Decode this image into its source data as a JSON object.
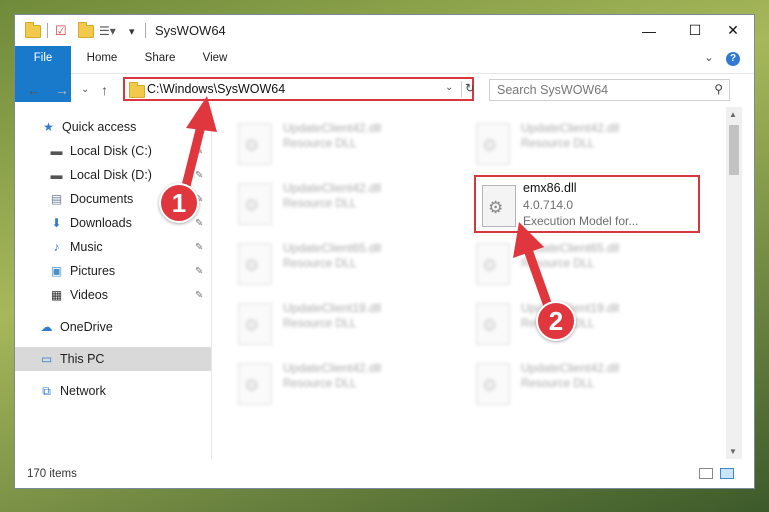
{
  "window": {
    "title": "SysWOW64",
    "controls": {
      "minimize": "—",
      "maximize": "☐",
      "close": "✕"
    }
  },
  "ribbon": {
    "tabs": [
      "File",
      "Home",
      "Share",
      "View"
    ],
    "expand": "⌄",
    "help": "?"
  },
  "nav": {
    "back": "←",
    "forward": "→",
    "recent": "⌄",
    "up": "↑"
  },
  "address": {
    "path": "C:\\Windows\\SysWOW64",
    "dropdown": "⌄",
    "refresh": "↻"
  },
  "search": {
    "placeholder": "Search SysWOW64",
    "icon": "search-icon"
  },
  "sidebar": {
    "items": [
      {
        "label": "Quick access",
        "icon": "star-icon",
        "glyph": "★",
        "color": "#2f7bd1",
        "pinned": false
      },
      {
        "label": "Local Disk (C:)",
        "icon": "drive-icon",
        "glyph": "▬",
        "color": "#555555",
        "pinned": true
      },
      {
        "label": "Local Disk (D:)",
        "icon": "drive-icon",
        "glyph": "▬",
        "color": "#555555",
        "pinned": true
      },
      {
        "label": "Documents",
        "icon": "documents-icon",
        "glyph": "▤",
        "color": "#6b7f99",
        "pinned": true
      },
      {
        "label": "Downloads",
        "icon": "download-icon",
        "glyph": "⬇",
        "color": "#2f7bd1",
        "pinned": true
      },
      {
        "label": "Music",
        "icon": "music-icon",
        "glyph": "♪",
        "color": "#2f7bd1",
        "pinned": true
      },
      {
        "label": "Pictures",
        "icon": "pictures-icon",
        "glyph": "▣",
        "color": "#4a90c8",
        "pinned": true
      },
      {
        "label": "Videos",
        "icon": "videos-icon",
        "glyph": "▦",
        "color": "#333333",
        "pinned": true
      },
      {
        "label": "OneDrive",
        "icon": "cloud-icon",
        "glyph": "☁",
        "color": "#2f7bd1",
        "pinned": false
      },
      {
        "label": "This PC",
        "icon": "computer-icon",
        "glyph": "▭",
        "color": "#2f7bd1",
        "pinned": false,
        "selected": true
      },
      {
        "label": "Network",
        "icon": "network-icon",
        "glyph": "⧉",
        "color": "#2f7bd1",
        "pinned": false
      }
    ],
    "pin_glyph": "📌"
  },
  "files": {
    "left": [
      {
        "name": "UpdateClient42.dll",
        "desc": "Resource DLL"
      },
      {
        "name": "UpdateClient42.dll",
        "desc": "Resource DLL"
      },
      {
        "name": "UpdateClient65.dll",
        "desc": "Resource DLL"
      },
      {
        "name": "UpdateClient19.dll",
        "desc": "Resource DLL"
      },
      {
        "name": "UpdateClient42.dll",
        "desc": "Resource DLL"
      }
    ],
    "right": [
      {
        "name": "UpdateClient42.dll",
        "desc": "Resource DLL"
      },
      {
        "name": "UpdateClient65.dll",
        "desc": "Resource DLL"
      },
      {
        "name": "UpdateClient19.dll",
        "desc": "Resource DLL"
      },
      {
        "name": "UpdateClient42.dll",
        "desc": "Resource DLL"
      }
    ],
    "highlighted": {
      "name": "emx86.dll",
      "version": "4.0.714.0",
      "desc": "Execution Model for..."
    }
  },
  "status": {
    "count": "170 items"
  },
  "annotations": {
    "step1": "1",
    "step2": "2",
    "color": "#e0373f"
  }
}
